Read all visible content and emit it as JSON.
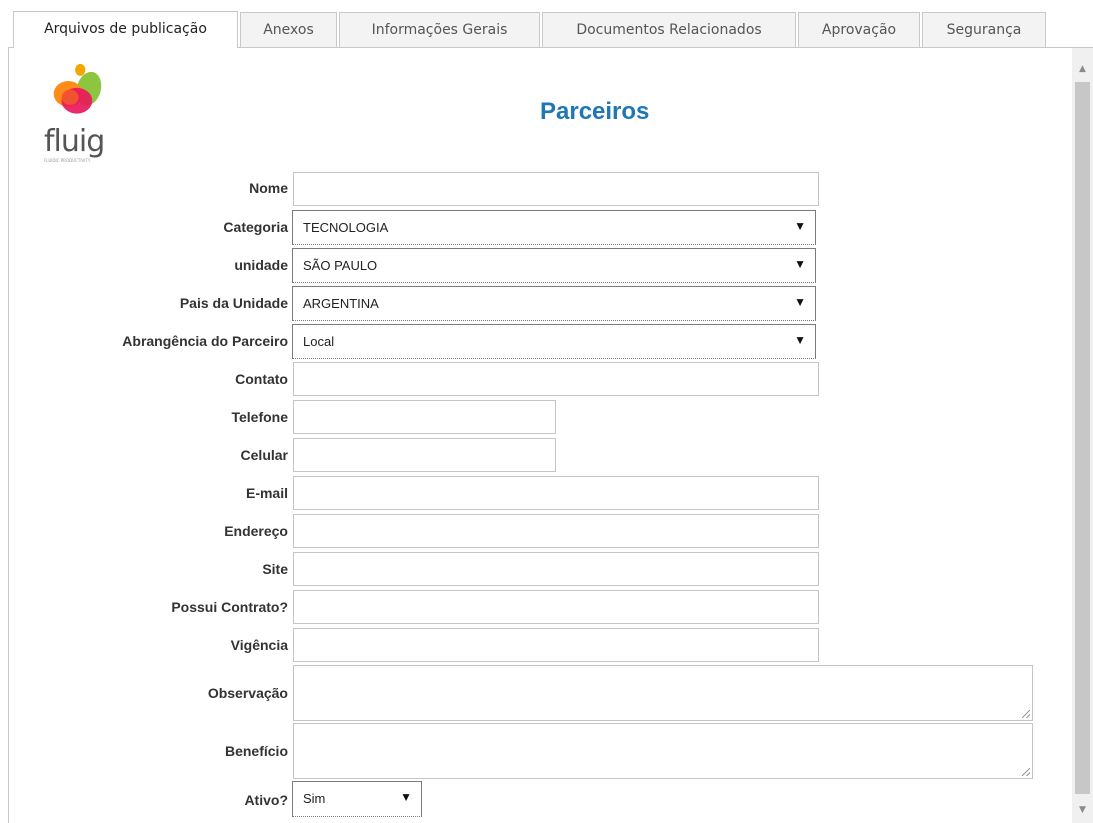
{
  "tabs": [
    {
      "label": "Arquivos de publicação",
      "active": true
    },
    {
      "label": "Anexos"
    },
    {
      "label": "Informações Gerais"
    },
    {
      "label": "Documentos Relacionados"
    },
    {
      "label": "Aprovação"
    },
    {
      "label": "Segurança"
    }
  ],
  "logo": {
    "text": "fluig",
    "subtext": "FLUIDIC PRODUCTIVITY"
  },
  "form": {
    "title": "Parceiros",
    "nome": {
      "label": "Nome",
      "value": ""
    },
    "categoria": {
      "label": "Categoria",
      "value": "TECNOLOGIA"
    },
    "unidade": {
      "label": "unidade",
      "value": "SÃO PAULO"
    },
    "pais": {
      "label": "Pais da Unidade",
      "value": "ARGENTINA"
    },
    "abrangencia": {
      "label": "Abrangência do Parceiro",
      "value": "Local"
    },
    "contato": {
      "label": "Contato",
      "value": ""
    },
    "telefone": {
      "label": "Telefone",
      "value": ""
    },
    "celular": {
      "label": "Celular",
      "value": ""
    },
    "email": {
      "label": "E-mail",
      "value": ""
    },
    "endereco": {
      "label": "Endereço",
      "value": ""
    },
    "site": {
      "label": "Site",
      "value": ""
    },
    "contrato": {
      "label": "Possui Contrato?",
      "value": ""
    },
    "vigencia": {
      "label": "Vigência",
      "value": ""
    },
    "observacao": {
      "label": "Observação",
      "value": ""
    },
    "beneficio": {
      "label": "Benefício",
      "value": ""
    },
    "ativo": {
      "label": "Ativo?",
      "value": "Sim"
    }
  },
  "colors": {
    "title": "#1f78b4",
    "border": "#c5c5c5"
  }
}
